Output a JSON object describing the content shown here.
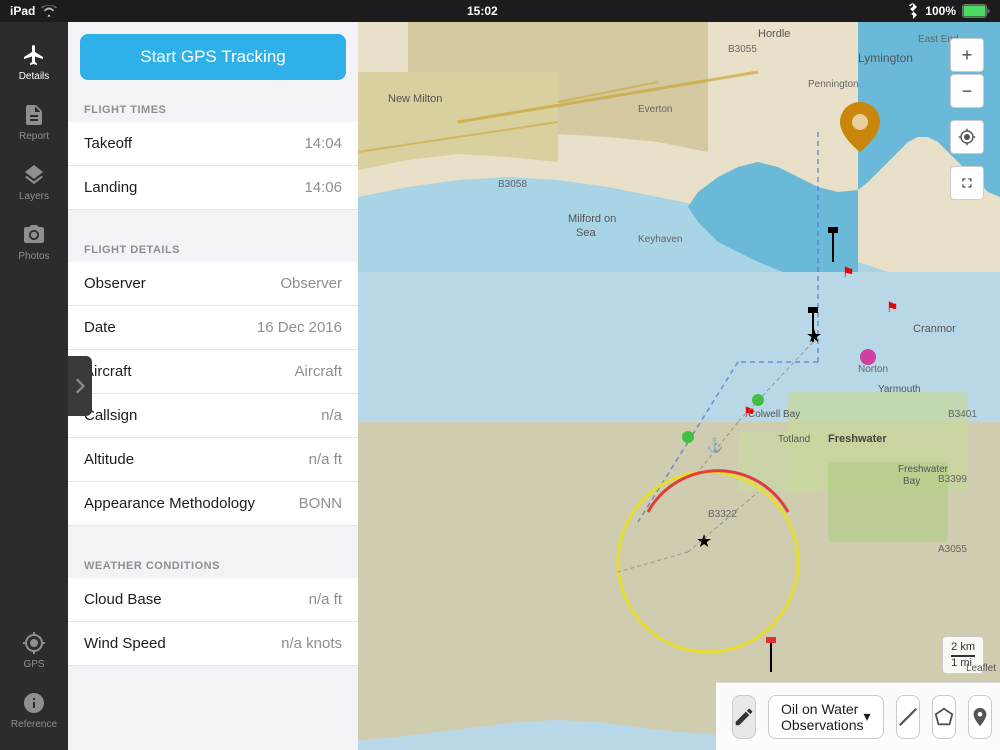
{
  "status_bar": {
    "carrier": "iPad",
    "time": "15:02",
    "battery": "100%",
    "wifi_icon": "wifi",
    "battery_icon": "battery"
  },
  "sidebar": {
    "items": [
      {
        "id": "details",
        "label": "Details",
        "icon": "plane",
        "active": true
      },
      {
        "id": "report",
        "label": "Report",
        "icon": "doc"
      },
      {
        "id": "layers",
        "label": "Layers",
        "icon": "layers"
      },
      {
        "id": "photos",
        "label": "Photos",
        "icon": "camera"
      }
    ],
    "bottom_items": [
      {
        "id": "gps",
        "label": "GPS",
        "icon": "gps"
      },
      {
        "id": "reference",
        "label": "Reference",
        "icon": "info"
      }
    ]
  },
  "panel": {
    "gps_button": "Start GPS Tracking",
    "flight_times_header": "FLIGHT TIMES",
    "flight_times": [
      {
        "label": "Takeoff",
        "value": "14:04"
      },
      {
        "label": "Landing",
        "value": "14:06"
      }
    ],
    "flight_details_header": "FLIGHT DETAILS",
    "flight_details": [
      {
        "label": "Observer",
        "value": "Observer"
      },
      {
        "label": "Date",
        "value": "16 Dec 2016"
      },
      {
        "label": "Aircraft",
        "value": "Aircraft"
      },
      {
        "label": "Callsign",
        "value": "n/a"
      },
      {
        "label": "Altitude",
        "value": "n/a  ft"
      },
      {
        "label": "Appearance Methodology",
        "value": "BONN"
      }
    ],
    "weather_header": "WEATHER CONDITIONS",
    "weather_details": [
      {
        "label": "Cloud Base",
        "value": "n/a  ft"
      },
      {
        "label": "Wind Speed",
        "value": "n/a  knots"
      }
    ]
  },
  "map": {
    "zoom_in": "+",
    "zoom_out": "−",
    "observation_label": "Oil on Water Observations",
    "scale_2km": "2 km",
    "scale_1mi": "1 mi",
    "leaflet": "Leaflet"
  },
  "toolbar": {
    "pencil_icon": "pencil",
    "line_icon": "line",
    "polygon_icon": "polygon",
    "pin_icon": "pin",
    "dropdown_arrow": "▾"
  }
}
